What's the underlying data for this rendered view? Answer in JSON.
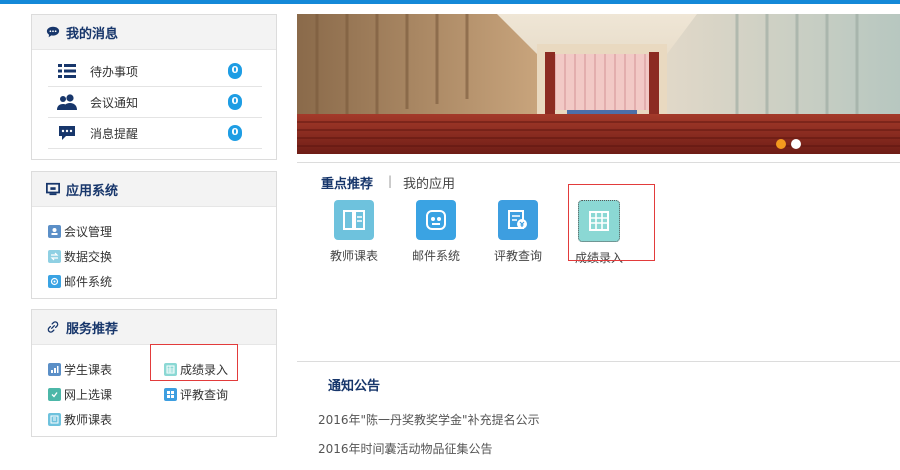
{
  "messages": {
    "title": "我的消息",
    "items": [
      {
        "label": "待办事项",
        "count": "0"
      },
      {
        "label": "会议通知",
        "count": "0"
      },
      {
        "label": "消息提醒",
        "count": "0"
      }
    ]
  },
  "apps_panel": {
    "title": "应用系统",
    "items": [
      {
        "label": "会议管理"
      },
      {
        "label": "数据交换"
      },
      {
        "label": "邮件系统"
      }
    ]
  },
  "services": {
    "title": "服务推荐",
    "items": [
      {
        "label": "学生课表"
      },
      {
        "label": "成绩录入"
      },
      {
        "label": "网上选课"
      },
      {
        "label": "评教查询"
      },
      {
        "label": "教师课表"
      }
    ]
  },
  "banner": {
    "slide_count": 2,
    "active_slide": 1
  },
  "tabs": {
    "active": "重点推荐",
    "separator": "|",
    "other": "我的应用"
  },
  "app_grid": [
    {
      "label": "教师课表",
      "icon": "book-icon",
      "color": "#6ec2dd"
    },
    {
      "label": "邮件系统",
      "icon": "mail-icon",
      "color": "#3aa3e3"
    },
    {
      "label": "评教查询",
      "icon": "query-icon",
      "color": "#3d9ee0"
    },
    {
      "label": "成绩录入",
      "icon": "grade-table-icon",
      "color": "#8bd8d4"
    }
  ],
  "notices": {
    "title": "通知公告",
    "items": [
      "2016年\"陈一丹奖教奖学金\"补充提名公示",
      "2016年时间囊活动物品征集公告"
    ]
  },
  "colors": {
    "accent": "#1489d8",
    "heading": "#17366b",
    "badge": "#1e9de4",
    "highlight_border": "#e23b3b"
  }
}
